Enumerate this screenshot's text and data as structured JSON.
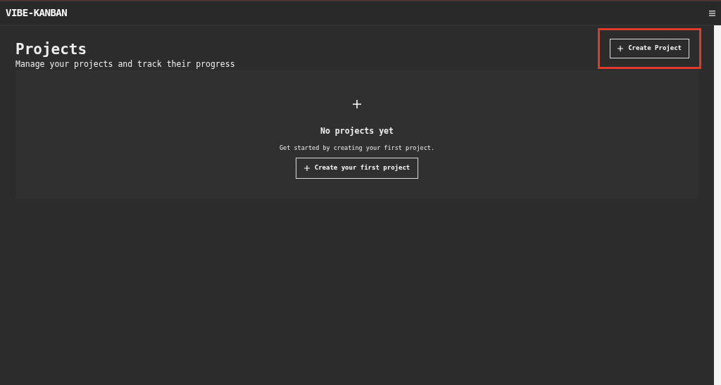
{
  "navbar": {
    "logo": "VIBE-KANBAN"
  },
  "header": {
    "title": "Projects",
    "subtitle": "Manage your projects and track their progress",
    "action": {
      "label": "Create Project",
      "highlighted": true
    }
  },
  "empty_state": {
    "title": "No projects yet",
    "message": "Get started by creating your first project.",
    "action": {
      "label": "Create your first project"
    }
  }
}
